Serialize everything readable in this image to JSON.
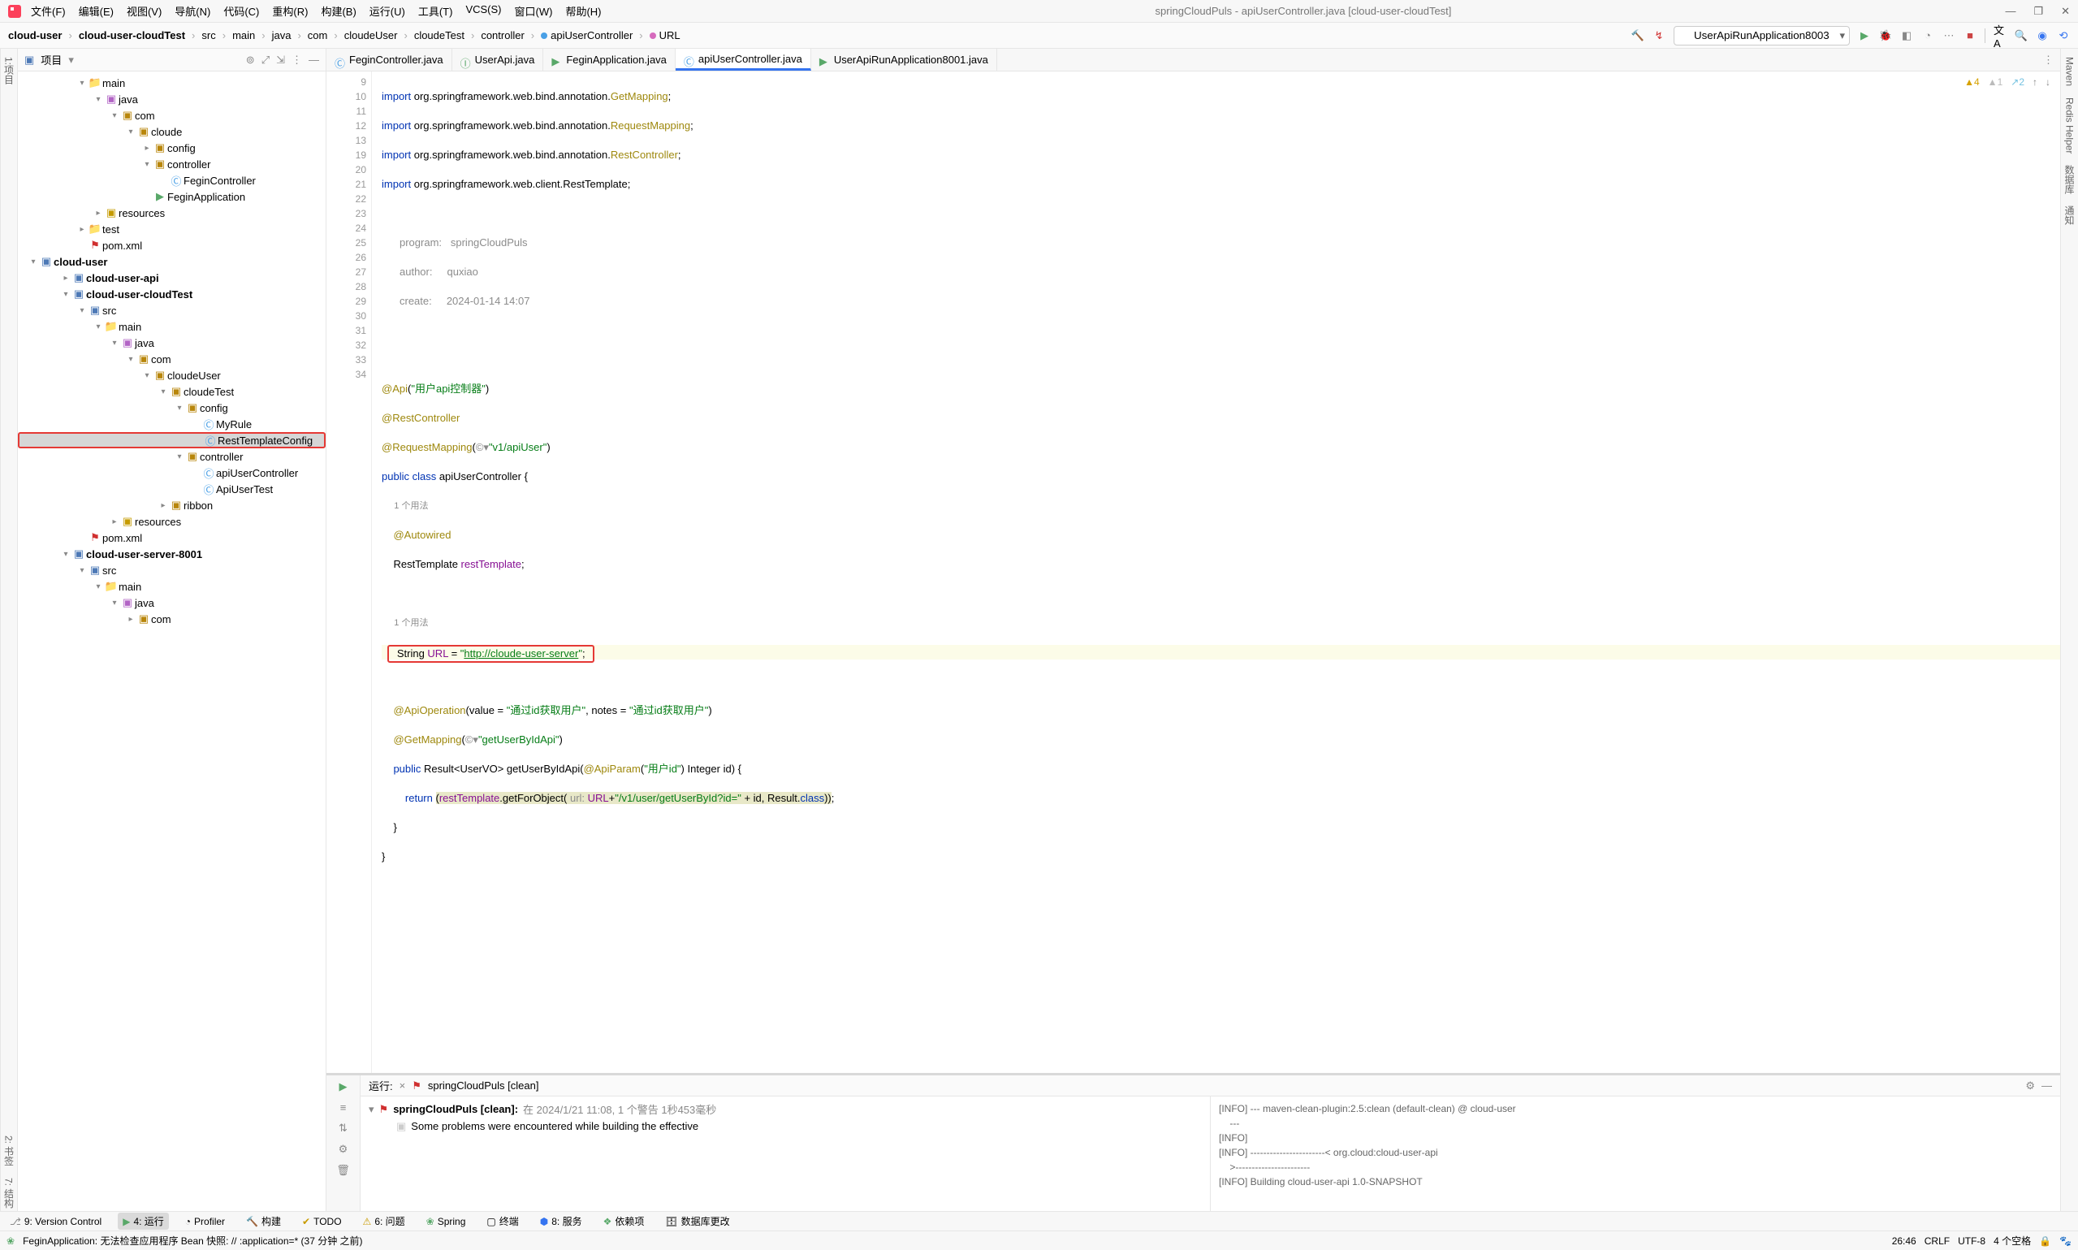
{
  "title": "springCloudPuls - apiUserController.java [cloud-user-cloudTest]",
  "menus": [
    "文件(F)",
    "编辑(E)",
    "视图(V)",
    "导航(N)",
    "代码(C)",
    "重构(R)",
    "构建(B)",
    "运行(U)",
    "工具(T)",
    "VCS(S)",
    "窗口(W)",
    "帮助(H)"
  ],
  "breadcrumbs": [
    "cloud-user",
    "cloud-user-cloudTest",
    "src",
    "main",
    "java",
    "com",
    "cloudeUser",
    "cloudeTest",
    "controller"
  ],
  "breadcrumb_class": "apiUserController",
  "breadcrumb_field": "URL",
  "run_config": "UserApiRunApplication8003",
  "left_tabs": [
    "1:项目"
  ],
  "right_tabs": [
    "Maven",
    "Redis Helper",
    "数据库",
    "通知"
  ],
  "bookmark_tabs": [
    "2: 书签",
    "7: 结构"
  ],
  "project_header": "项目",
  "tree": {
    "main": "main",
    "java": "java",
    "com": "com",
    "cloude": "cloude",
    "config": "config",
    "controller": "controller",
    "FeginController": "FeginController",
    "FeginApplication": "FeginApplication",
    "resources": "resources",
    "test": "test",
    "pomxml": "pom.xml",
    "cloud_user": "cloud-user",
    "cloud_user_api": "cloud-user-api",
    "cloud_user_cloudTest": "cloud-user-cloudTest",
    "src": "src",
    "cloudeUser": "cloudeUser",
    "cloudeTest": "cloudeTest",
    "MyRule": "MyRule",
    "RestTemplateConfig": "RestTemplateConfig",
    "apiUserController": "apiUserController",
    "ApiUserTest": "ApiUserTest",
    "ribbon": "ribbon",
    "cloud_user_server_8001": "cloud-user-server-8001"
  },
  "tabs": [
    {
      "label": "FeginController.java",
      "active": false,
      "color": "#3b82c4"
    },
    {
      "label": "UserApi.java",
      "active": false,
      "color": "#59a869"
    },
    {
      "label": "FeginApplication.java",
      "active": false,
      "color": "#59a869"
    },
    {
      "label": "apiUserController.java",
      "active": true,
      "color": "#3b82c4"
    },
    {
      "label": "UserApiRunApplication8001.java",
      "active": false,
      "color": "#59a869"
    }
  ],
  "inspections": {
    "err4": "4",
    "warn1": "1",
    "weak2": "2"
  },
  "code": {
    "l9": "import org.springframework.web.bind.annotation.GetMapping;",
    "l10": "import org.springframework.web.bind.annotation.RequestMapping;",
    "l11": "import org.springframework.web.bind.annotation.RestController;",
    "l12": "import org.springframework.web.client.RestTemplate;",
    "doc_program_k": "program:",
    "doc_program_v": "springCloudPuls",
    "doc_author_k": "author:",
    "doc_author_v": "quxiao",
    "doc_create_k": "create:",
    "doc_create_v": "2024-01-14 14:07",
    "l19": "@Api(\"用户api控制器\")",
    "l20": "@RestController",
    "l21a": "@RequestMapping(",
    "l21b": "\"v1/apiUser\"",
    "l21c": ")",
    "l22": "public class apiUserController {",
    "usage1": "1 个用法",
    "l23": "@Autowired",
    "l24a": "RestTemplate ",
    "l24b": "restTemplate",
    "l24c": ";",
    "usage2": "1 个用法",
    "l26a": "String ",
    "l26b": "URL",
    "l26c": " = ",
    "l26d": "\"",
    "l26e": "http://cloude-user-server",
    "l26f": "\";",
    "l28a": "@ApiOperation(value = ",
    "l28b": "\"通过id获取用户\"",
    "l28c": ", notes = ",
    "l28d": "\"通过id获取用户\"",
    "l28e": ")",
    "l29a": "@GetMapping(",
    "l29b": "\"getUserByIdApi\"",
    "l29c": ")",
    "l30": "public Result<UserVO> getUserByIdApi(@ApiParam(\"用户id\") Integer id) {",
    "l31a": "    return ",
    "l31b": "(restTemplate.getForObject(",
    "l31url": " url: ",
    "l31c": "URL+",
    "l31d": "\"/v1/user/getUserById?id=\"",
    "l31e": " + id, Result.class));",
    "l32": "}",
    "l33": "}"
  },
  "gutter_lines": [
    "9",
    "10",
    "11",
    "12",
    "13",
    "",
    "",
    "",
    "",
    "",
    "19",
    "20",
    "21",
    "22",
    "",
    "23",
    "24",
    "25",
    "",
    "26",
    "27",
    "28",
    "29",
    "30",
    "31",
    "32",
    "33",
    "34"
  ],
  "run": {
    "label": "运行:",
    "title": "springCloudPuls [clean]",
    "head": "springCloudPuls [clean]:",
    "head_time": "在 2024/1/21 11:08,  1 个警告 1秒453毫秒",
    "problem": "Some problems were encountered while building the effective",
    "console": [
      "[INFO] --- maven-clean-plugin:2.5:clean (default-clean) @ cloud-user",
      "    ---",
      "[INFO]",
      "[INFO] -----------------------< org.cloud:cloud-user-api",
      "    >-----------------------",
      "[INFO] Building cloud-user-api 1.0-SNAPSHOT"
    ]
  },
  "toolstrip": {
    "version_control": "9: Version Control",
    "run": "4: 运行",
    "profiler": "Profiler",
    "build": "构建",
    "todo": "TODO",
    "problems": "6: 问题",
    "spring": "Spring",
    "terminal": "终端",
    "services": "8: 服务",
    "deps": "依赖项",
    "db": "数据库更改"
  },
  "status": {
    "msg": "FeginApplication: 无法检查应用程序 Bean 快照: // :application=* (37 分钟 之前)",
    "pos": "26:46",
    "crlf": "CRLF",
    "enc": "UTF-8",
    "indent": "4 个空格"
  }
}
